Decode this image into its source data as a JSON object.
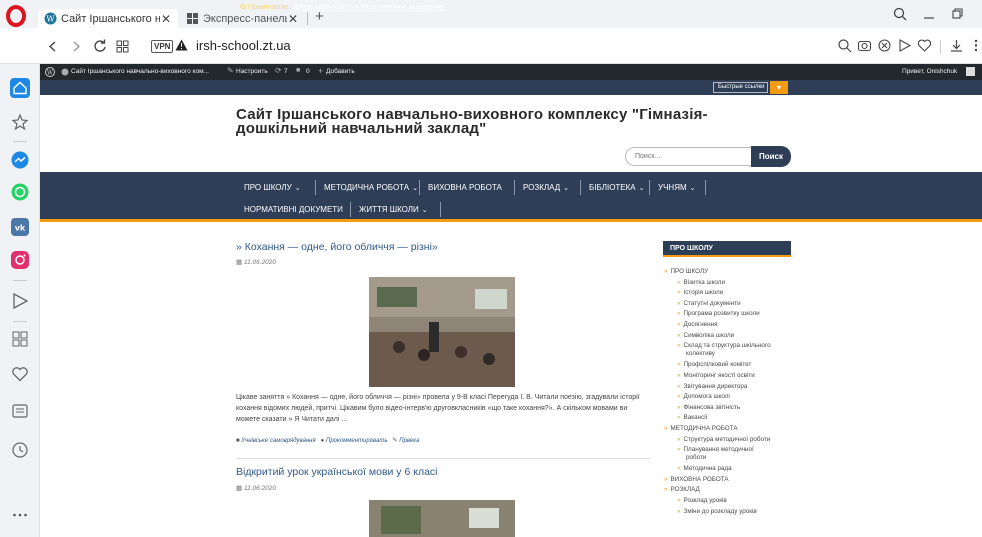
{
  "browser": {
    "tabs": [
      {
        "title": "Сайт Іршанського навчаль",
        "active": true
      },
      {
        "title": "Экспресс-панель",
        "active": false
      }
    ],
    "url": "irsh-school.zt.ua",
    "vpn_label": "VPN",
    "new_tab": "+",
    "close_glyph": "✕"
  },
  "admin_bar": {
    "site_name": "Сайт Іршанського навчально-виховного ком...",
    "customize": "Настроить",
    "updates": "7",
    "comments": "0",
    "add_new": "Добавить",
    "greeting": "Привет, Onishchuk"
  },
  "notice": {
    "label": "Примечание:",
    "link": "Добро пожаловать в наше учебное заведение!",
    "quick_links": "Быстрые ссылки"
  },
  "site": {
    "title": "Сайт Іршанського навчально-виховного комплексу \"Гімназія-дошкільний навчальний заклад\"",
    "search_placeholder": "Поиск...",
    "search_button": "Поиск"
  },
  "nav": [
    {
      "label": "ПРО ШКОЛУ",
      "caret": true
    },
    {
      "label": "МЕТОДИЧНА РОБОТА",
      "caret": true
    },
    {
      "label": "ВИХОВНА РОБОТА",
      "caret": false
    },
    {
      "label": "РОЗКЛАД",
      "caret": true
    },
    {
      "label": "БІБЛІОТЕКА",
      "caret": true
    },
    {
      "label": "УЧНЯМ",
      "caret": true
    },
    {
      "label": "НОРМАТИВНІ ДОКУМЕТИ",
      "caret": false
    },
    {
      "label": "ЖИТТЯ ШКОЛИ",
      "caret": true
    }
  ],
  "posts": [
    {
      "title": "» Кохання — одне, його обличчя — різні»",
      "date": "11.06.2020",
      "excerpt": "Цікаве заняття » Кохання — одне, його обличчя — різні» провела у 9-В класі Перегуда І. В. Читали поезію, згадували історії кохання відомих людей, притчі. Цікавим було відео-інтерв'ю друговкласників «що таке кохання?». А скільком мовами ви можете сказати » Я Читати далі ...",
      "category": "Учнівське самоврядування",
      "comments": "Прокомментировать",
      "author": "Првека"
    },
    {
      "title": "Відкритий урок української мови у 6 класі",
      "date": "11.06.2020"
    }
  ],
  "widget": {
    "title": "ПРО ШКОЛУ",
    "items": [
      {
        "label": "ПРО ШКОЛУ",
        "level": 0
      },
      {
        "label": "Візитка школи",
        "level": 1
      },
      {
        "label": "Історія школи",
        "level": 1
      },
      {
        "label": "Статутні документи",
        "level": 1
      },
      {
        "label": "Програма розвитку школи",
        "level": 1
      },
      {
        "label": "Досягнення",
        "level": 1
      },
      {
        "label": "Символіка школи",
        "level": 1
      },
      {
        "label": "Склад та структура шкільного",
        "label2": "колективу",
        "level": 1
      },
      {
        "label": "Профспілковий комітет",
        "level": 1
      },
      {
        "label": "Моніторинг якості освіти",
        "level": 1
      },
      {
        "label": "Звітування директора",
        "level": 1
      },
      {
        "label": "Допомога школі",
        "level": 1
      },
      {
        "label": "Фінансова звітність",
        "level": 1
      },
      {
        "label": "Вакансії",
        "level": 1
      },
      {
        "label": "МЕТОДИЧНА РОБОТА",
        "level": 0
      },
      {
        "label": "Структура методичної роботи",
        "level": 1
      },
      {
        "label": "Планування методичної",
        "label2": "роботи",
        "level": 1
      },
      {
        "label": "Методична рада",
        "level": 1
      },
      {
        "label": "ВИХОВНА РОБОТА",
        "level": 0
      },
      {
        "label": "РОЗКЛАД",
        "level": 0
      },
      {
        "label": "Розклад уроків",
        "level": 1
      },
      {
        "label": "Зміни до розкладу уроків",
        "level": 1
      }
    ]
  },
  "colors": {
    "nav_bg": "#2e3e57",
    "accent": "#f39c12",
    "link": "#2f5a8a",
    "admin_bg": "#23282d"
  },
  "icons": {
    "opera": "opera-icon",
    "wordpress": "wordpress-icon"
  }
}
